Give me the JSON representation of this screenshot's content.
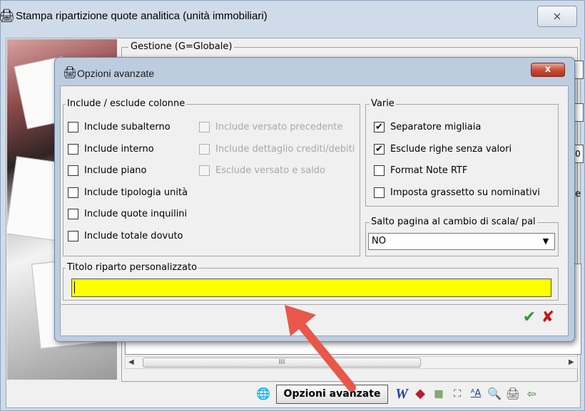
{
  "outer": {
    "title": "Stampa ripartizione quote analitica (unità immobiliari)",
    "close_glyph": "⨯",
    "group_label": "Gestione (G=Globale)",
    "peek_values": [
      "0",
      "e"
    ],
    "scroll_thumb": "III"
  },
  "toolbar": {
    "opzioni_label": "Opzioni avanzate",
    "icons": [
      "globe-icon",
      "word-icon",
      "cube-icon",
      "table-icon",
      "frame-icon",
      "font-icon",
      "zoom-icon",
      "printer-icon",
      "exit-icon"
    ]
  },
  "dialog": {
    "title": "Opzioni avanzate",
    "close_glyph": "x",
    "includes": {
      "label": "Include / esclude colonne",
      "col1": [
        {
          "label": "Include subalterno",
          "checked": false
        },
        {
          "label": "Include interno",
          "checked": false
        },
        {
          "label": "Include piano",
          "checked": false
        },
        {
          "label": "Include tipologia unità",
          "checked": false
        },
        {
          "label": "Include quote inquilini",
          "checked": false
        },
        {
          "label": "Include totale dovuto",
          "checked": false
        }
      ],
      "col2": [
        {
          "label": "Include versato precedente",
          "checked": false
        },
        {
          "label": "Include dettaglio crediti/debiti",
          "checked": false
        },
        {
          "label": "Esclude versato e saldo",
          "checked": false
        }
      ]
    },
    "varie": {
      "label": "Varie",
      "items": [
        {
          "label": "Separatore migliaia",
          "checked": true
        },
        {
          "label": "Esclude righe senza valori",
          "checked": true
        },
        {
          "label": "Format Note RTF",
          "checked": false
        },
        {
          "label": "Imposta grassetto su nominativi",
          "checked": false
        }
      ]
    },
    "salto": {
      "label": "Salto pagina al cambio di scala/ pal",
      "value": "NO"
    },
    "titolo": {
      "label": "Titolo riparto personalizzato",
      "value": "",
      "bg_color": "#ffff00"
    },
    "ok_glyph": "✔",
    "cancel_glyph": "✘"
  },
  "colors": {
    "accent_arrow": "#e8574a",
    "ok": "#2e9a2e",
    "cancel": "#d01010"
  }
}
